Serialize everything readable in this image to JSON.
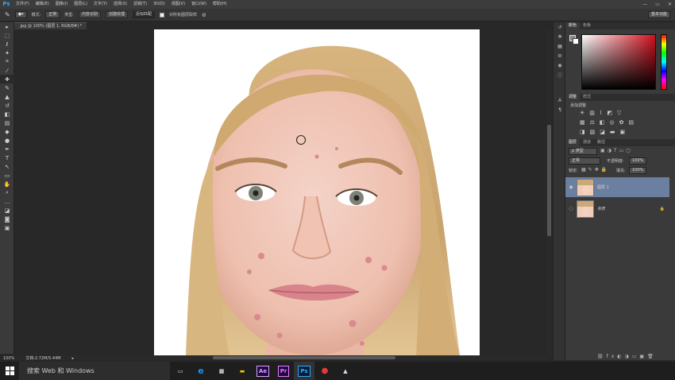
{
  "app": {
    "logo": "Ps"
  },
  "menu": [
    "文件(F)",
    "编辑(E)",
    "图像(I)",
    "图层(L)",
    "文字(Y)",
    "选择(S)",
    "滤镜(T)",
    "3D(D)",
    "视图(V)",
    "窗口(W)",
    "帮助(H)"
  ],
  "options": {
    "mode_label": "模式:",
    "mode_value": "正常",
    "type_label": "类型:",
    "type_btn1": "内容识别",
    "type_btn2": "创建纹理",
    "type_btn3": "近似匹配",
    "sample_all": "对所有图层取样",
    "workspace": "基本功能"
  },
  "document": {
    "tab": ".jpg @ 100% (图层 1, RGB/8#) *"
  },
  "status": {
    "zoom": "100%",
    "doc_info": "文档:2.72M/5.44M"
  },
  "panels": {
    "color_tab": "颜色",
    "swatches_tab": "色板",
    "adjust_tab": "调整",
    "styles_tab": "样式",
    "adjust_title": "添加调整",
    "layers_tab": "图层",
    "channels_tab": "通道",
    "paths_tab": "路径",
    "kind": "ρ 类型",
    "blend": "正常",
    "opacity_label": "不透明度:",
    "opacity": "100%",
    "lock_label": "锁定:",
    "fill_label": "填充:",
    "fill": "100%",
    "layers": [
      {
        "name": "图层 1",
        "selected": true
      },
      {
        "name": "背景",
        "selected": false
      }
    ]
  },
  "taskbar": {
    "search": "搜索 Web 和 Windows"
  },
  "colors": {
    "accent": "#31a8ff",
    "selected_layer": "#6b7fa0"
  }
}
